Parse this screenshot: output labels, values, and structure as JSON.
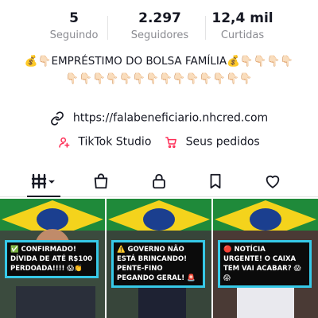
{
  "stats": [
    {
      "value": "5",
      "label": "Seguindo"
    },
    {
      "value": "2.297",
      "label": "Seguidores"
    },
    {
      "value": "12,4 mil",
      "label": "Curtidas"
    }
  ],
  "bio": {
    "text": "💰👇🏻EMPRÉSTIMO DO BOLSA FAMÍLIA💰👇🏻👇🏻👇🏻👇🏻👇🏻👇🏻👇🏻👇🏻👇🏻👇🏻👇🏻👇🏻👇🏻👇🏻👇🏻👇🏻👇🏻👇🏻"
  },
  "link": {
    "url": "https://falabeneficiario.nhcred.com",
    "icon": "link-icon"
  },
  "tools": [
    {
      "label": "TikTok Studio",
      "icon": "studio-person-icon"
    },
    {
      "label": "Seus pedidos",
      "icon": "cart-icon"
    }
  ],
  "tabs": [
    {
      "name": "videos-grid",
      "icon": "grid-bars-icon",
      "active": true
    },
    {
      "name": "shop",
      "icon": "shopping-bag-icon"
    },
    {
      "name": "private",
      "icon": "lock-icon"
    },
    {
      "name": "favorites",
      "icon": "bookmark-icon"
    },
    {
      "name": "liked",
      "icon": "heart-icon"
    }
  ],
  "videos": [
    {
      "caption": "✅ CONFIRMADO! DÍVIDA DE ATÉ R$100 PERDOADA!!!! 😱👏"
    },
    {
      "caption": "⚠️ GOVERNO NÃO ESTÁ BRINCANDO! PENTE-FINO PEGANDO GERAL! 🚨"
    },
    {
      "caption": "🔴 NOTÍCIA URGENTE! O CAIXA TEM VAI ACABAR? 😱😱"
    }
  ],
  "colors": {
    "accent_red": "#fe2c55",
    "caption_border": "#36c9e8",
    "flag_green": "#1f8a3a",
    "flag_yellow": "#f4d31c",
    "flag_blue": "#1b3f8f"
  }
}
